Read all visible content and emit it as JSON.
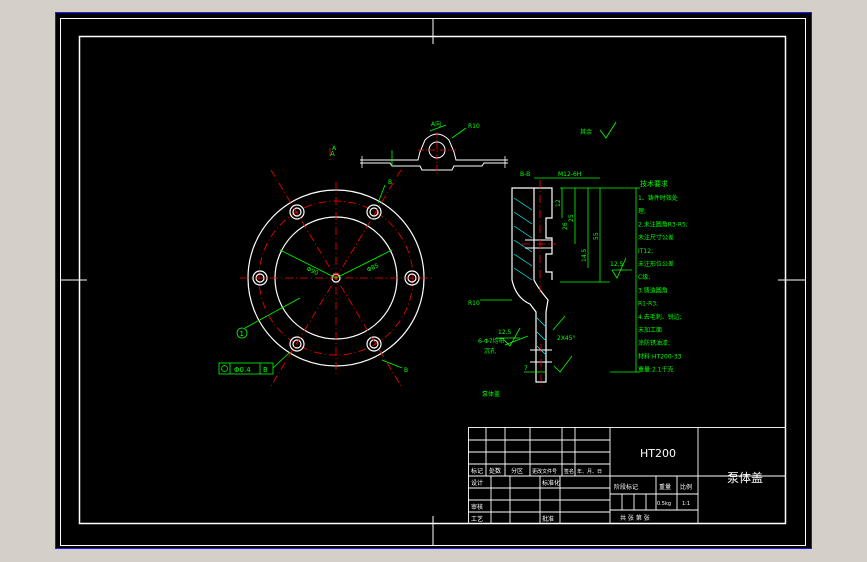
{
  "colors": {
    "window_bg": "#d4d0c8",
    "canvas_bg": "#000000",
    "line": "#ffffff",
    "center_line": "#ff0000",
    "dim": "#00ff00",
    "hatch": "#00ffff",
    "blue_frame": "#1a1aff"
  },
  "views": {
    "top_a_label": "A",
    "top_a_dim": "A向",
    "top_r_dim": "R10",
    "front_a_left": "A",
    "front_b_top": "B",
    "front_b_bottom": "B",
    "front_dia_left": "Φ90",
    "front_dia_right": "Φ85",
    "front_callout": "1",
    "tolerance_dia": "Φ0.4",
    "tolerance_ref": "B",
    "section_label": "B-B",
    "section_thread": "M12-6H",
    "section_dims_small": [
      "12",
      "25",
      "26",
      "14.5"
    ],
    "section_dim_height": "55",
    "section_roughness_right": "12.5",
    "section_roughness_left": "12.5",
    "section_chamfer": "2X45°",
    "section_r": "R10",
    "section_seven": "7",
    "section_holes_label": "6-Φ7均布",
    "section_holes_sub": "沉孔",
    "part_caption": "泵体盖",
    "surface_mark": "其余"
  },
  "notes": {
    "title": "技术要求",
    "lines": [
      "1、铸件时效处",
      "理;",
      "2.未注圆角R3-R5;",
      "未注尺寸公差",
      "IT12;",
      "未注形位公差",
      "C级;",
      "3.铸造圆角",
      "R1-R3;",
      "4.去毛刺、锐边;",
      "未加工面",
      "涂防锈油漆;",
      "材料:HT200-33",
      "重量:2.1千克"
    ]
  },
  "title_block": {
    "material": "HT200",
    "part_name": "泵体盖",
    "row_heads": [
      "标记",
      "处数",
      "分区",
      "更改文件号",
      "签名",
      "年、月、日"
    ],
    "design": "设计",
    "standard": "标准化",
    "review": "审核",
    "process": "工艺",
    "approve": "批准",
    "stage_mark": "阶段标记",
    "weight_head": "重量",
    "scale_head": "比例",
    "weight_val": "0.5kg",
    "scale_val": "1:1",
    "sheets": "共  张  第  张"
  }
}
